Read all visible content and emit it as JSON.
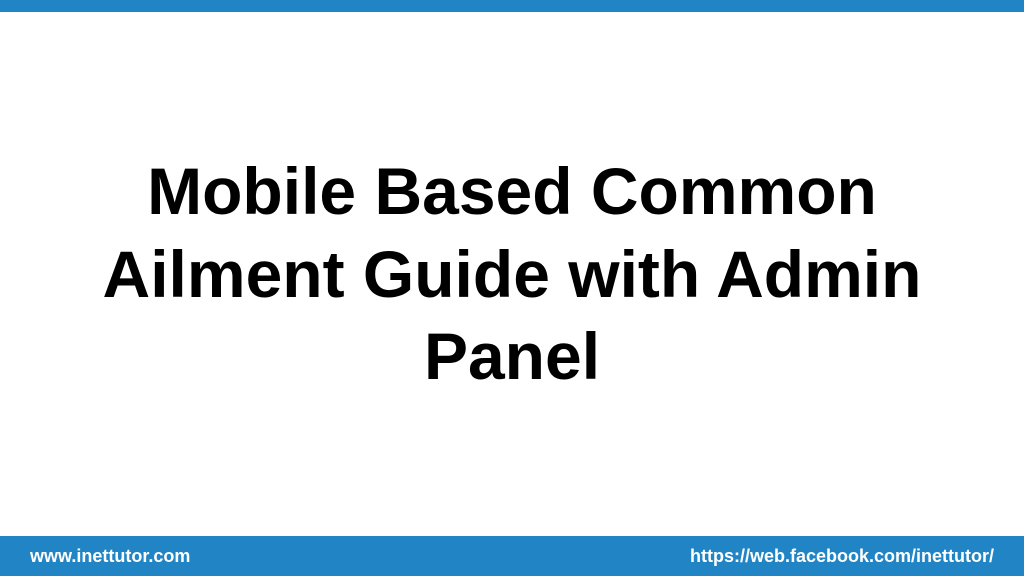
{
  "main": {
    "title": "Mobile Based Common Ailment Guide with Admin Panel"
  },
  "footer": {
    "left": "www.inettutor.com",
    "right": "https://web.facebook.com/inettutor/"
  },
  "colors": {
    "accent": "#2185c5"
  }
}
